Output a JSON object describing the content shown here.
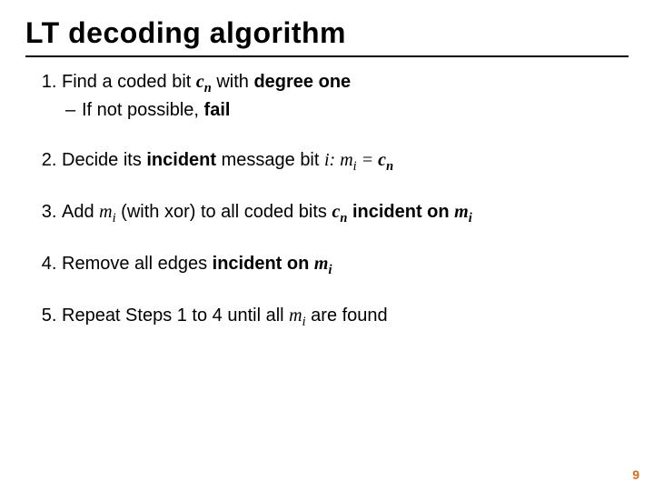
{
  "title": "LT  decoding algorithm",
  "items": {
    "s1a": "Find a coded bit ",
    "s1c": "c",
    "s1n": "n",
    "s1b": " with ",
    "s1deg": "degree one",
    "s1sub_dash": "–  ",
    "s1sub_a": "If not possible, ",
    "s1sub_fail": "fail",
    "s2a": "Decide its ",
    "s2inc": "incident",
    "s2b": " message bit ",
    "s2i": "i: m",
    "s2isub": "i",
    "s2eq": " = ",
    "s2c": "c",
    "s2n": "n",
    "s3a": "Add ",
    "s3m": "m",
    "s3i": "i",
    "s3b": " (with xor) to all coded bits ",
    "s3c": "c",
    "s3n": "n",
    "s3sp": " ",
    "s3inc": "incident on ",
    "s3m2": "m",
    "s3i2": "i",
    "s4a": "Remove all edges ",
    "s4inc": "incident on ",
    "s4m": "m",
    "s4i": "i",
    "s5a": "Repeat Steps 1 to 4 until all ",
    "s5m": "m",
    "s5i": "i",
    "s5b": " are found"
  },
  "page_number": "9",
  "colors": {
    "accent": "#d96c1e"
  }
}
